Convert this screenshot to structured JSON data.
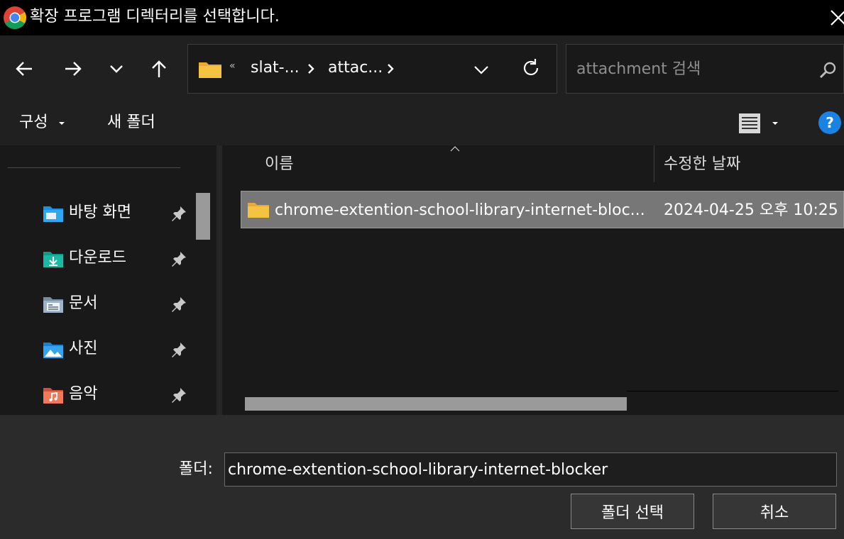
{
  "window": {
    "title": "확장 프로그램 디렉터리를 선택합니다."
  },
  "nav": {
    "address_overflow": "«",
    "path": [
      "slat-...",
      "attac..."
    ],
    "search_placeholder": "attachment 검색"
  },
  "commands": {
    "organize": "구성",
    "new_folder": "새 폴더",
    "help": "?"
  },
  "sidebar": {
    "items": [
      {
        "label": "바탕 화면",
        "icon": "desktop-folder-icon"
      },
      {
        "label": "다운로드",
        "icon": "downloads-folder-icon"
      },
      {
        "label": "문서",
        "icon": "documents-folder-icon"
      },
      {
        "label": "사진",
        "icon": "pictures-folder-icon"
      },
      {
        "label": "음악",
        "icon": "music-folder-icon"
      }
    ]
  },
  "filelist": {
    "columns": {
      "name": "이름",
      "date": "수정한 날짜"
    },
    "rows": [
      {
        "name": "chrome-extention-school-library-internet-bloc...",
        "date": "2024-04-25 오후 10:25"
      }
    ]
  },
  "footer": {
    "folder_label": "폴더:",
    "folder_value": "chrome-extention-school-library-internet-blocker",
    "select_button": "폴더 선택",
    "cancel_button": "취소"
  },
  "colors": {
    "accent": "#1a82e2",
    "folder_yellow": "#f5c342",
    "selection": "#777777"
  }
}
